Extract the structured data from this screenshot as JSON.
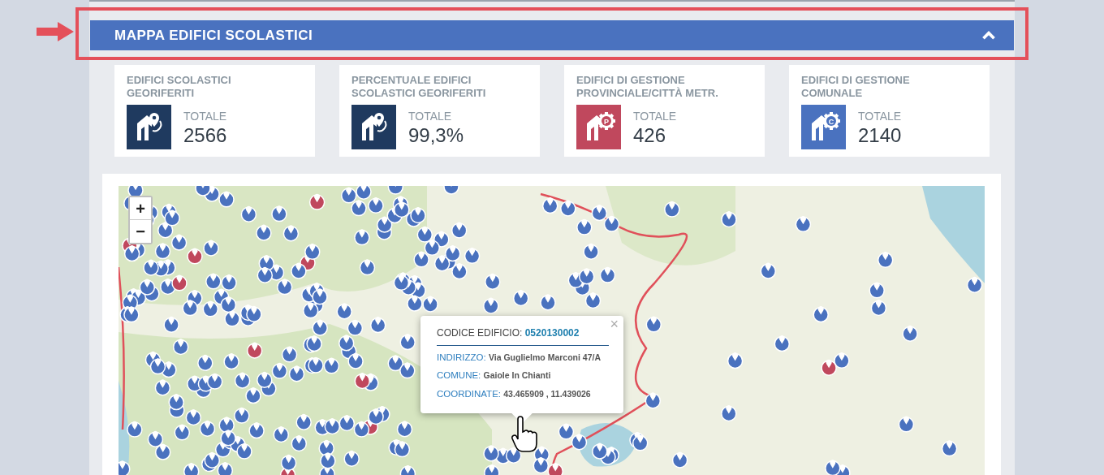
{
  "section": {
    "title": "MAPPA EDIFICI SCOLASTICI",
    "expanded": true
  },
  "stats": [
    {
      "title": "EDIFICI SCOLASTICI GEORIFERITI",
      "kind": "pin",
      "color": "#1f3a5f",
      "label": "TOTALE",
      "value": "2566"
    },
    {
      "title": "PERCENTUALE EDIFICI SCOLASTICI GEORIFERITI",
      "kind": "pin",
      "color": "#1f3a5f",
      "label": "TOTALE",
      "value": "99,3%"
    },
    {
      "title": "EDIFICI DI GESTIONE PROVINCIALE/CITTÀ METR.",
      "kind": "gear",
      "letter": "P",
      "color": "#c0485d",
      "label": "TOTALE",
      "value": "426"
    },
    {
      "title": "EDIFICI DI GESTIONE COMUNALE",
      "kind": "gear",
      "letter": "C",
      "color": "#4a72bf",
      "label": "TOTALE",
      "value": "2140"
    }
  ],
  "map": {
    "zoom_in": "+",
    "zoom_out": "−",
    "popup": {
      "close": "×",
      "code_label": "CODICE EDIFICIO:",
      "code": "0520130002",
      "fields": [
        {
          "label": "INDIRIZZO:",
          "value": "Via Guglielmo Marconi 47/A"
        },
        {
          "label": "COMUNE:",
          "value": "Gaiole In Chianti"
        },
        {
          "label": "COORDINATE:",
          "value": "43.465909 , 11.439026"
        }
      ]
    }
  }
}
